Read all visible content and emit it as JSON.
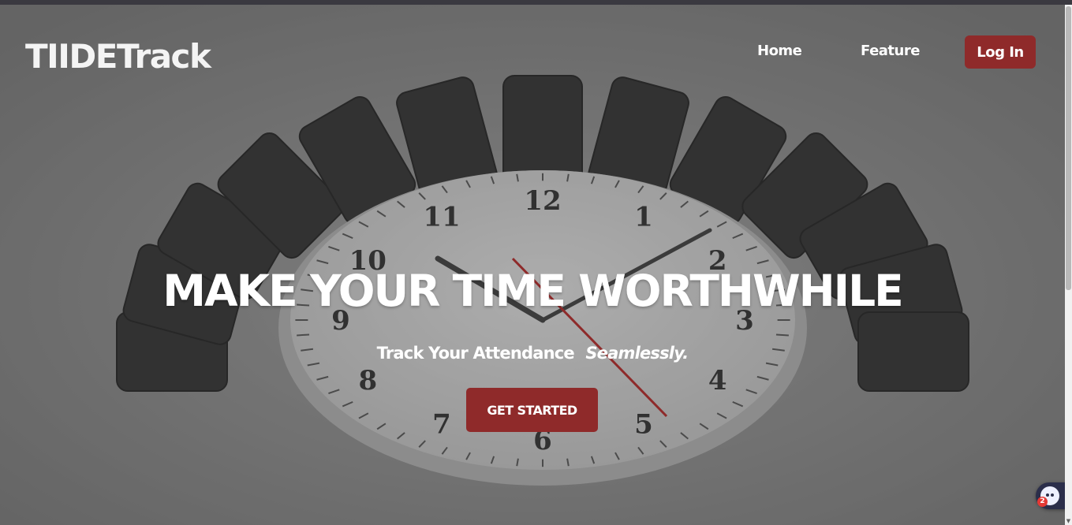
{
  "nav": {
    "brand": "TIIDETrack",
    "home_label": "Home",
    "feature_label": "Feature",
    "login_label": "Log In"
  },
  "hero": {
    "headline": "MAKE YOUR TIME WORTHWHILE",
    "subline_main": "Track Your Attendance",
    "subline_emphasis": "Seamlessly.",
    "cta_label": "GET STARTED",
    "clock_numbers": [
      "12",
      "1",
      "2",
      "3",
      "4",
      "5",
      "6",
      "7",
      "8",
      "9",
      "10",
      "11"
    ]
  },
  "chat_widget": {
    "icon": "chat-bot-icon",
    "badge_count": "2"
  },
  "colors": {
    "accent": "#8f2a2a",
    "text": "#ffffff",
    "overlay": "#6a6a6a"
  }
}
